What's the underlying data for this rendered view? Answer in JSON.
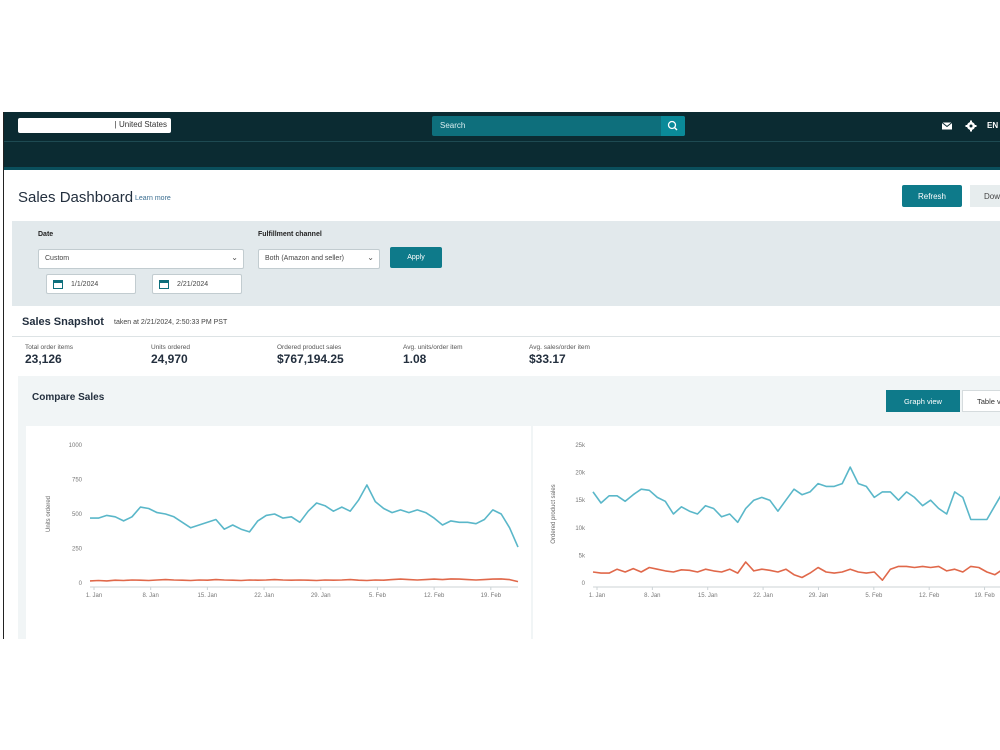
{
  "header": {
    "marketplace": "| United States",
    "search_placeholder": "Search",
    "language": "EN"
  },
  "page": {
    "title": "Sales Dashboard",
    "learn_more": "Learn more",
    "refresh_label": "Refresh",
    "download_label": "Dow"
  },
  "filters": {
    "date_label": "Date",
    "date_value": "Custom",
    "start_date": "1/1/2024",
    "end_date": "2/21/2024",
    "channel_label": "Fulfillment channel",
    "channel_value": "Both (Amazon and seller)",
    "apply_label": "Apply"
  },
  "snapshot": {
    "title": "Sales Snapshot",
    "taken_at": "taken at 2/21/2024, 2:50:33 PM PST",
    "metrics": [
      {
        "label": "Total order items",
        "value": "23,126"
      },
      {
        "label": "Units ordered",
        "value": "24,970"
      },
      {
        "label": "Ordered product sales",
        "value": "$767,194.25"
      },
      {
        "label": "Avg. units/order item",
        "value": "1.08"
      },
      {
        "label": "Avg. sales/order item",
        "value": "$33.17"
      }
    ]
  },
  "compare": {
    "title": "Compare Sales",
    "graph_view_label": "Graph view",
    "table_view_label": "Table v"
  },
  "colors": {
    "teal": "#5ab7c9",
    "salmon": "#e0684a",
    "accent": "#0e7a8a",
    "topbar": "#0b2b32"
  },
  "icons": [
    "search-icon",
    "mail-icon",
    "gear-icon",
    "calendar-icon",
    "chevron-down-icon"
  ],
  "chart_data": [
    {
      "type": "line",
      "ylabel": "Units ordered",
      "ylim": [
        0,
        1000
      ],
      "yticks": [
        "1000",
        "750",
        "500",
        "250",
        "0"
      ],
      "xticks": [
        "1. Jan",
        "8. Jan",
        "15. Jan",
        "22. Jan",
        "29. Jan",
        "5. Feb",
        "12. Feb",
        "19. Feb"
      ],
      "series": [
        {
          "color": "#5ab7c9",
          "values": [
            470,
            470,
            490,
            480,
            450,
            480,
            550,
            540,
            510,
            500,
            480,
            440,
            400,
            420,
            440,
            460,
            390,
            420,
            390,
            370,
            450,
            490,
            500,
            470,
            480,
            440,
            520,
            580,
            560,
            520,
            550,
            520,
            600,
            710,
            590,
            540,
            510,
            530,
            510,
            530,
            510,
            470,
            420,
            450,
            440,
            440,
            430,
            460,
            530,
            500,
            400,
            260
          ]
        },
        {
          "color": "#e0684a",
          "values": [
            15,
            18,
            15,
            20,
            18,
            22,
            20,
            18,
            22,
            25,
            22,
            20,
            18,
            22,
            20,
            25,
            22,
            20,
            18,
            22,
            20,
            22,
            25,
            22,
            20,
            22,
            20,
            18,
            22,
            20,
            22,
            25,
            20,
            18,
            22,
            20,
            25,
            28,
            25,
            22,
            25,
            28,
            25,
            30,
            28,
            25,
            22,
            25,
            28,
            30,
            25,
            10
          ]
        }
      ]
    },
    {
      "type": "line",
      "ylabel": "Ordered product sales",
      "ylim": [
        0,
        25000
      ],
      "yticks": [
        "25k",
        "20k",
        "15k",
        "10k",
        "5k",
        "0"
      ],
      "xticks": [
        "1. Jan",
        "8. Jan",
        "15. Jan",
        "22. Jan",
        "29. Jan",
        "5. Feb",
        "12. Feb",
        "19. Feb"
      ],
      "series": [
        {
          "color": "#5ab7c9",
          "values": [
            16500,
            14500,
            15800,
            15800,
            14800,
            16000,
            17000,
            16800,
            15500,
            14800,
            12500,
            13800,
            13000,
            12500,
            14000,
            13500,
            12000,
            12500,
            11000,
            13500,
            15000,
            15500,
            15000,
            13000,
            15000,
            17000,
            16000,
            16500,
            18000,
            17500,
            17500,
            18000,
            21000,
            18000,
            17500,
            15500,
            16500,
            16500,
            15000,
            16500,
            15500,
            14000,
            15000,
            13500,
            12500,
            16500,
            15500,
            11500,
            11500,
            11500,
            14000,
            16500,
            16500
          ]
        },
        {
          "color": "#e0684a",
          "values": [
            2000,
            1800,
            1800,
            2500,
            2000,
            2600,
            2000,
            2800,
            2500,
            2200,
            2000,
            2400,
            2300,
            2000,
            2500,
            2200,
            2000,
            2500,
            1800,
            3800,
            2200,
            2500,
            2300,
            2000,
            2500,
            1500,
            1000,
            1800,
            2800,
            2000,
            1800,
            2000,
            2500,
            2000,
            1800,
            2000,
            500,
            2500,
            3000,
            3000,
            2800,
            3000,
            2800,
            3000,
            2200,
            2500,
            2000,
            3000,
            2800,
            2000,
            1500,
            2500,
            3000
          ]
        }
      ]
    }
  ]
}
